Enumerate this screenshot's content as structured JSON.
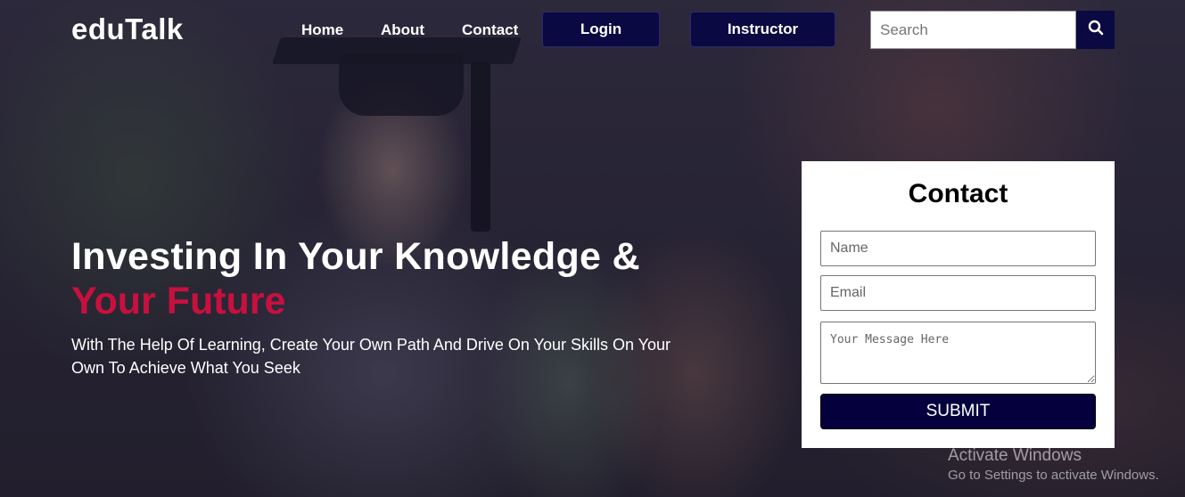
{
  "brand": {
    "logo_text": "eduTalk"
  },
  "nav": {
    "home": "Home",
    "about": "About",
    "contact": "Contact",
    "login": "Login",
    "instructor": "Instructor"
  },
  "search": {
    "placeholder": "Search",
    "value": "",
    "icon": "search-icon"
  },
  "hero": {
    "headline": "Investing In Your Knowledge &",
    "headline_accent": "Your Future",
    "subtext": "With The Help Of Learning, Create Your Own Path And Drive On Your Skills On Your Own To Achieve What You Seek"
  },
  "contact_form": {
    "title": "Contact",
    "name_placeholder": "Name",
    "email_placeholder": "Email",
    "message_placeholder": "Your Message Here",
    "submit_label": "SUBMIT"
  },
  "watermark": {
    "title": "Activate Windows",
    "subtitle": "Go to Settings to activate Windows."
  },
  "colors": {
    "accent": "#c8103f",
    "button_bg": "#0a0942",
    "submit_bg": "#05003d"
  }
}
